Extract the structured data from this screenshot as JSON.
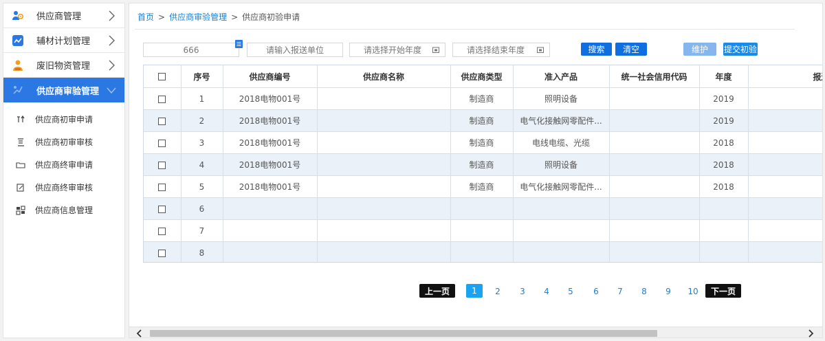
{
  "sidebar": {
    "items": [
      {
        "label": "供应商管理",
        "icon": "supplier-people-icon"
      },
      {
        "label": "辅材计划管理",
        "icon": "chart-plan-icon"
      },
      {
        "label": "废旧物资管理",
        "icon": "person-scrap-icon"
      },
      {
        "label": "供应商审验管理",
        "icon": "audit-icon"
      }
    ],
    "sub_items": [
      {
        "label": "供应商初审申请",
        "icon": "apply-icon"
      },
      {
        "label": "供应商初审审核",
        "icon": "review-doc-icon"
      },
      {
        "label": "供应商终审申请",
        "icon": "folder-icon"
      },
      {
        "label": "供应商终审审核",
        "icon": "edit-doc-icon"
      },
      {
        "label": "供应商信息管理",
        "icon": "info-grid-icon"
      }
    ],
    "active_color": "#2b78e4"
  },
  "breadcrumb": {
    "home": "首页",
    "parent": "供应商审验管理",
    "current": "供应商初验申请",
    "separator": ">"
  },
  "toolbar": {
    "input_value": "666",
    "unit_placeholder": "请输入报送单位",
    "start_year_placeholder": "请选择开始年度",
    "end_year_placeholder": "请选择结束年度",
    "search_label": "搜索",
    "clear_label": "清空",
    "maintain_label": "维护",
    "submit_label": "提交初验"
  },
  "table": {
    "headers": [
      "序号",
      "供应商编号",
      "供应商名称",
      "供应商类型",
      "准入产品",
      "统一社会信用代码",
      "年度",
      "报送单"
    ],
    "rows": [
      {
        "no": "1",
        "code": "2018电物001号",
        "name": "",
        "type": "制造商",
        "product": "照明设备",
        "credit": "",
        "year": "2019",
        "unit": ""
      },
      {
        "no": "2",
        "code": "2018电物001号",
        "name": "",
        "type": "制造商",
        "product": "电气化接触网零配件...",
        "credit": "",
        "year": "2019",
        "unit": ""
      },
      {
        "no": "3",
        "code": "2018电物001号",
        "name": "",
        "type": "制造商",
        "product": "电线电缆、光缆",
        "credit": "",
        "year": "2018",
        "unit": ""
      },
      {
        "no": "4",
        "code": "2018电物001号",
        "name": "",
        "type": "制造商",
        "product": "照明设备",
        "credit": "",
        "year": "2018",
        "unit": ""
      },
      {
        "no": "5",
        "code": "2018电物001号",
        "name": "",
        "type": "制造商",
        "product": "电气化接触网零配件...",
        "credit": "",
        "year": "2018",
        "unit": ""
      },
      {
        "no": "6",
        "code": "",
        "name": "",
        "type": "",
        "product": "",
        "credit": "",
        "year": "",
        "unit": ""
      },
      {
        "no": "7",
        "code": "",
        "name": "",
        "type": "",
        "product": "",
        "credit": "",
        "year": "",
        "unit": ""
      },
      {
        "no": "8",
        "code": "",
        "name": "",
        "type": "",
        "product": "",
        "credit": "",
        "year": "",
        "unit": ""
      }
    ]
  },
  "pagination": {
    "prev_label": "上一页",
    "next_label": "下一页",
    "pages": [
      "1",
      "2",
      "3",
      "4",
      "5",
      "6",
      "7",
      "8",
      "9",
      "10"
    ],
    "current_page": "1"
  }
}
